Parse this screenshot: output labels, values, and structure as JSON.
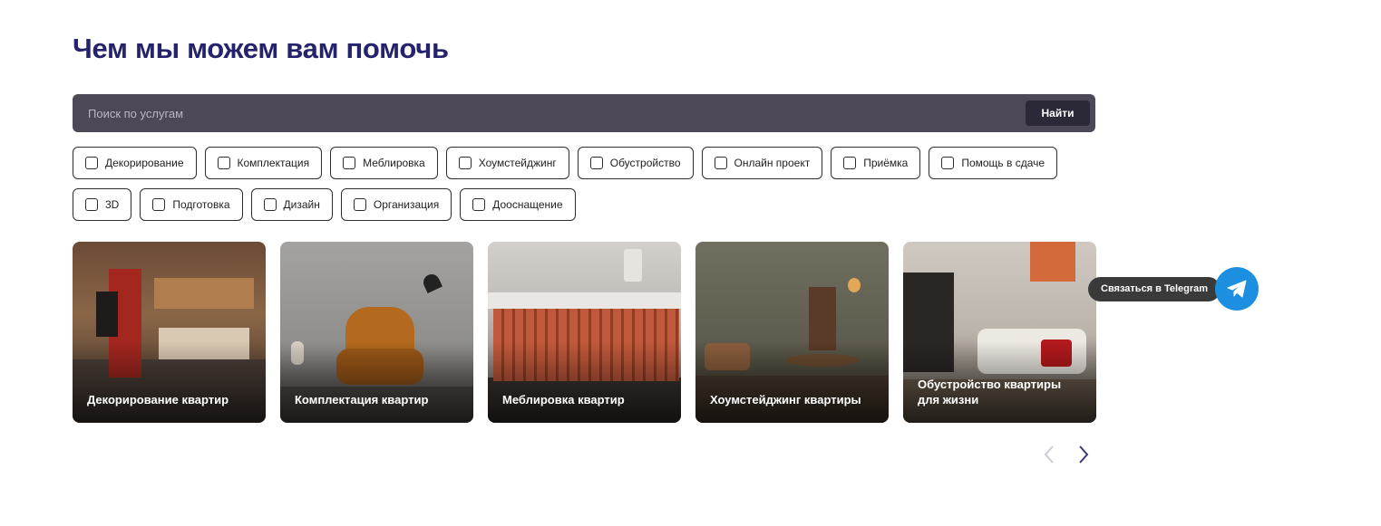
{
  "section": {
    "title": "Чем мы можем вам помочь"
  },
  "search": {
    "placeholder": "Поиск по услугам",
    "value": "",
    "button_label": "Найти"
  },
  "filters": {
    "row1": [
      {
        "label": "Декорирование",
        "checked": false
      },
      {
        "label": "Комплектация",
        "checked": false
      },
      {
        "label": "Меблировка",
        "checked": false
      },
      {
        "label": "Хоумстейджинг",
        "checked": false
      },
      {
        "label": "Обустройство",
        "checked": false
      },
      {
        "label": "Онлайн проект",
        "checked": false
      },
      {
        "label": "Приёмка",
        "checked": false
      },
      {
        "label": "Помощь в сдаче",
        "checked": false
      }
    ],
    "row2": [
      {
        "label": "3D",
        "checked": false
      },
      {
        "label": "Подготовка",
        "checked": false
      },
      {
        "label": "Дизайн",
        "checked": false
      },
      {
        "label": "Организация",
        "checked": false
      },
      {
        "label": "Дооснащение",
        "checked": false
      }
    ]
  },
  "cards": [
    {
      "title": "Декорирование квартир"
    },
    {
      "title": "Комплектация квартир"
    },
    {
      "title": "Меблировка квартир"
    },
    {
      "title": "Хоумстейджинг квартиры"
    },
    {
      "title": "Обустройство квартиры для жизни"
    }
  ],
  "pager": {
    "prev_icon": "chevron-left-icon",
    "next_icon": "chevron-right-icon",
    "prev_color": "#c9cbd6",
    "next_color": "#3d3a7a"
  },
  "telegram": {
    "label": "Связаться в Telegram",
    "icon": "telegram-plane-icon",
    "color": "#1d8fe0"
  },
  "colors": {
    "title": "#25236b",
    "search_bg": "#4c4858",
    "search_btn": "#2b2838"
  }
}
